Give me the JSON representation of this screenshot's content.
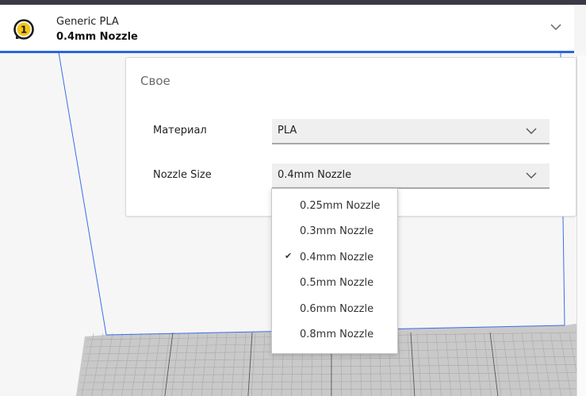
{
  "header": {
    "extruder_number": "1",
    "material": "Generic PLA",
    "nozzle": "0.4mm Nozzle"
  },
  "panel": {
    "title": "Свое",
    "rows": [
      {
        "label": "Материал",
        "value": "PLA"
      },
      {
        "label": "Nozzle Size",
        "value": "0.4mm Nozzle"
      }
    ]
  },
  "nozzle_options": [
    {
      "label": "0.25mm Nozzle",
      "checked": false
    },
    {
      "label": "0.3mm Nozzle",
      "checked": false
    },
    {
      "label": "0.4mm Nozzle",
      "checked": true
    },
    {
      "label": "0.5mm Nozzle",
      "checked": false
    },
    {
      "label": "0.6mm Nozzle",
      "checked": false
    },
    {
      "label": "0.8mm Nozzle",
      "checked": false
    }
  ],
  "check_glyph": "✔",
  "colors": {
    "accent": "#2866e0",
    "build_volume_edge": "#3a6ee8",
    "plate": "#c9c9c9"
  },
  "icons": {
    "extruder": "extruder-badge-icon",
    "chevron": "chevron-down-icon",
    "check": "check-icon"
  }
}
